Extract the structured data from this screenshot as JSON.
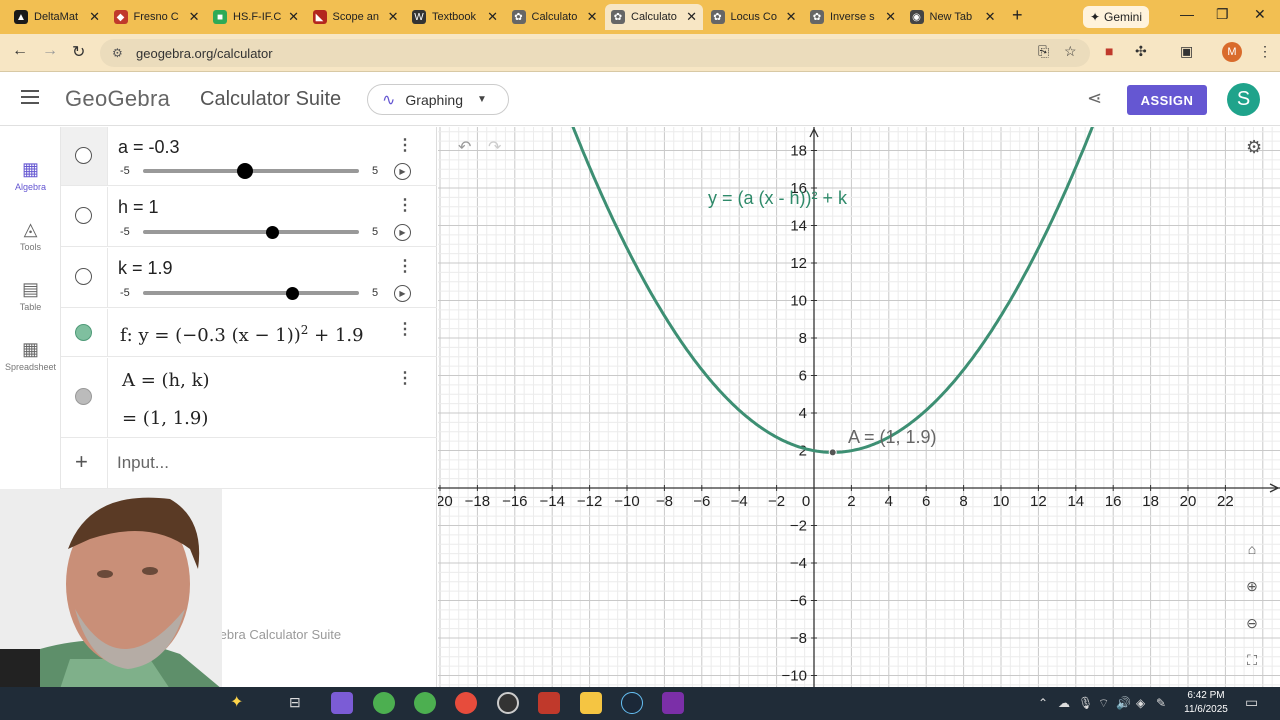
{
  "browser": {
    "tabs": [
      {
        "title": "DeltaMat",
        "color": "#1a1a1a",
        "glyph": "▲"
      },
      {
        "title": "Fresno C",
        "color": "#c0392b",
        "glyph": "◆"
      },
      {
        "title": "HS.F-IF.C",
        "color": "#2eaa56",
        "glyph": "■"
      },
      {
        "title": "Scope an",
        "color": "#b3261e",
        "glyph": "◣"
      },
      {
        "title": "Textbook",
        "color": "#333333",
        "glyph": "W"
      },
      {
        "title": "Calculato",
        "color": "#666666",
        "glyph": "✿"
      },
      {
        "title": "Calculato",
        "color": "#666666",
        "glyph": "✿"
      },
      {
        "title": "Locus Co",
        "color": "#666666",
        "glyph": "✿"
      },
      {
        "title": "Inverse s",
        "color": "#666666",
        "glyph": "✿"
      },
      {
        "title": "New Tab",
        "color": "#444444",
        "glyph": "◉"
      }
    ],
    "active_tab_index": 6,
    "gemini_label": "Gemini",
    "url": "geogebra.org/calculator"
  },
  "header": {
    "logo": "GeoGebra",
    "suite_title": "Calculator Suite",
    "app_selector": "Graphing",
    "assign_label": "ASSIGN",
    "avatar_letter": "S"
  },
  "rail": {
    "items": [
      {
        "label": "Algebra",
        "icon": "calculator-icon",
        "active": true
      },
      {
        "label": "Tools",
        "icon": "tools-icon",
        "active": false
      },
      {
        "label": "Table",
        "icon": "table-icon",
        "active": false
      },
      {
        "label": "Spreadsheet",
        "icon": "spreadsheet-icon",
        "active": false
      }
    ]
  },
  "algebra": {
    "sliders": [
      {
        "expr": "a = -0.3",
        "min": "-5",
        "max": "5",
        "value": -0.3
      },
      {
        "expr": "h = 1",
        "min": "-5",
        "max": "5",
        "value": 1
      },
      {
        "expr": "k = 1.9",
        "min": "-5",
        "max": "5",
        "value": 1.9
      }
    ],
    "function_main": "f: y = (−0.3 (x − 1))",
    "function_exp": "2",
    "function_tail": " + 1.9",
    "point_def": "A = (h, k)",
    "point_value": "= (1, 1.9)",
    "input_placeholder": "Input...",
    "watermark": "GeoGebra Calculator Suite"
  },
  "graph": {
    "curve_label": "y = (a (x - h))² + k",
    "point_label": "A = (1, 1.9)",
    "x_ticks": [
      -20,
      -18,
      -16,
      -14,
      -12,
      -10,
      -8,
      -6,
      -4,
      -2,
      0,
      2,
      4,
      6,
      8,
      10,
      12,
      14,
      16,
      18,
      20,
      22
    ],
    "y_ticks": [
      -10,
      -8,
      -6,
      -4,
      -2,
      2,
      4,
      6,
      8,
      10,
      12,
      14,
      16,
      18
    ],
    "curve_color": "#3d8f73",
    "a": -0.3,
    "h": 1,
    "k": 1.9
  },
  "taskbar": {
    "time": "6:42 PM",
    "date": "11/6/2025"
  }
}
